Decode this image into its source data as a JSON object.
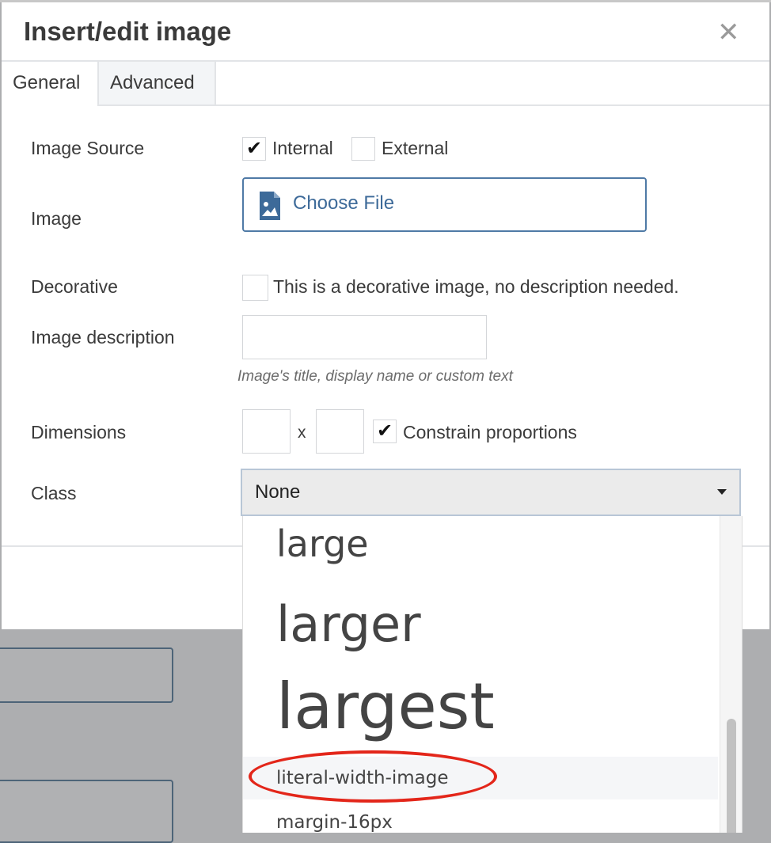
{
  "dialog": {
    "title": "Insert/edit image",
    "close_icon": "close-icon",
    "tabs": [
      {
        "label": "General",
        "active": true
      },
      {
        "label": "Advanced",
        "active": false
      }
    ]
  },
  "form": {
    "image_source": {
      "label": "Image Source",
      "internal": {
        "label": "Internal",
        "checked": true
      },
      "external": {
        "label": "External",
        "checked": false
      }
    },
    "image": {
      "label": "Image",
      "button_label": "Choose File",
      "icon": "file-image-icon"
    },
    "decorative": {
      "label": "Decorative",
      "checkbox_label": "This is a decorative image, no description needed.",
      "checked": false
    },
    "description": {
      "label": "Image description",
      "value": "",
      "hint": "Image's title, display name or custom text"
    },
    "dimensions": {
      "label": "Dimensions",
      "width": "",
      "height": "",
      "separator": "x",
      "constrain_label": "Constrain proportions",
      "constrain_checked": true
    },
    "class": {
      "label": "Class",
      "selected": "None"
    }
  },
  "dropdown": {
    "options": [
      "large",
      "larger",
      "largest",
      "literal-width-image",
      "margin-16px"
    ],
    "highlighted": "literal-width-image"
  },
  "colors": {
    "accent": "#3d6a99",
    "highlight_ring": "#e3261a",
    "overlay": "#adaeb0"
  }
}
